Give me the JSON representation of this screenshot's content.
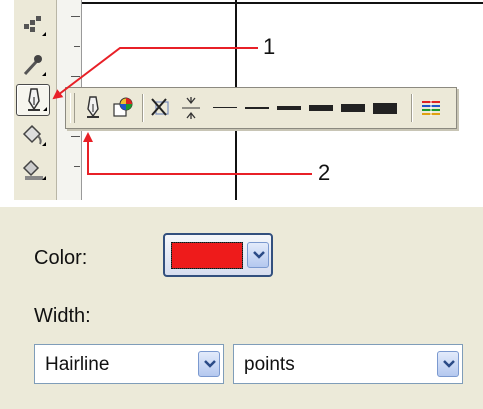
{
  "callouts": {
    "one": "1",
    "two": "2"
  },
  "toolbox": {
    "tools": [
      {
        "name": "shape-tool",
        "icon": "shape-edit-icon"
      },
      {
        "name": "eyedropper-tool",
        "icon": "eyedropper-icon"
      },
      {
        "name": "outline-tool",
        "icon": "pen-nib-icon",
        "active": true
      },
      {
        "name": "fill-tool",
        "icon": "paint-bucket-icon"
      },
      {
        "name": "interactive-fill-tool",
        "icon": "interactive-fill-icon"
      }
    ]
  },
  "outline_flyout": {
    "buttons": [
      {
        "name": "outline-pen-dialog",
        "icon": "pen-nib-icon"
      },
      {
        "name": "outline-color-dialog",
        "icon": "color-wheel-icon"
      },
      {
        "name": "no-outline",
        "icon": "no-outline-x-icon"
      },
      {
        "name": "hairline-outline",
        "icon": "hairline-arrows-icon"
      }
    ],
    "widths": [
      "thin",
      "half-point",
      "one-point",
      "two-point",
      "eight-point",
      "sixteen-point"
    ],
    "extra": {
      "name": "color-docker",
      "icon": "color-docker-icon"
    }
  },
  "dialog": {
    "color_label": "Color:",
    "color_value": "#ee1b1b",
    "width_label": "Width:",
    "width_value": "Hairline",
    "units_value": "points"
  }
}
